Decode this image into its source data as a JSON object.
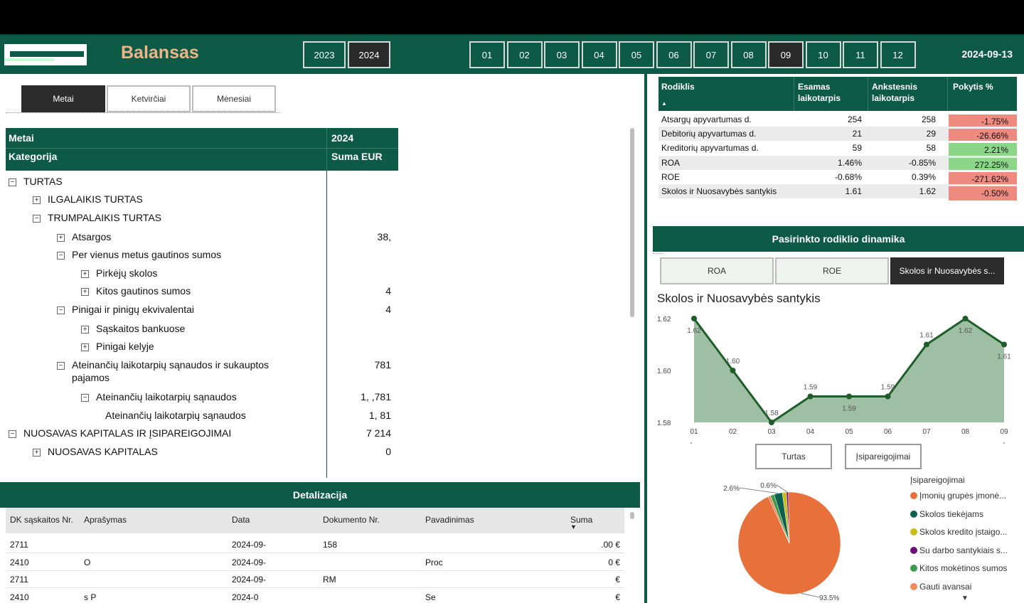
{
  "header": {
    "title": "Balansas",
    "years": [
      "2023",
      "2024"
    ],
    "selected_year": "2024",
    "months": [
      "01",
      "02",
      "03",
      "04",
      "05",
      "06",
      "07",
      "08",
      "09",
      "10",
      "11",
      "12"
    ],
    "selected_month": "09",
    "date": "2024-09-13"
  },
  "period_tabs": [
    "Metai",
    "Ketvirčiai",
    "Mėnesiai"
  ],
  "matrix": {
    "col1_row1": "Metai",
    "col2_row1": "2024",
    "col1_row2": "Kategorija",
    "col2_row2": "Suma EUR",
    "rows": [
      {
        "label": "TURTAS",
        "toggle": "−",
        "value": ""
      },
      {
        "label": "ILGALAIKIS TURTAS",
        "toggle": "+",
        "value": ""
      },
      {
        "label": "TRUMPALAIKIS TURTAS",
        "toggle": "−",
        "value": ""
      },
      {
        "label": "Atsargos",
        "toggle": "+",
        "value": "38,"
      },
      {
        "label": "Per vienus metus gautinos sumos",
        "toggle": "−",
        "value": ""
      },
      {
        "label": "Pirkėjų skolos",
        "toggle": "+",
        "value": ""
      },
      {
        "label": "Kitos gautinos sumos",
        "toggle": "+",
        "value": "4"
      },
      {
        "label": "Pinigai ir pinigų ekvivalentai",
        "toggle": "−",
        "value": "4"
      },
      {
        "label": "Sąskaitos bankuose",
        "toggle": "+",
        "value": ""
      },
      {
        "label": "Pinigai kelyje",
        "toggle": "+",
        "value": ""
      },
      {
        "label": "Ateinančių laikotarpių sąnaudos ir sukauptos",
        "label2": "pajamos",
        "toggle": "−",
        "value": "781"
      },
      {
        "label": "Ateinančių laikotarpių sąnaudos",
        "toggle": "−",
        "value": "1,    ,781"
      },
      {
        "label": "Ateinančių laikotarpių sąnaudos",
        "toggle": "",
        "value": "1,      81"
      },
      {
        "label": "NUOSAVAS KAPITALAS IR ĮSIPAREIGOJIMAI",
        "toggle": "−",
        "value": "7      214"
      },
      {
        "label": "NUOSAVAS KAPITALAS",
        "toggle": "+",
        "value": "0"
      }
    ]
  },
  "detail": {
    "title": "Detalizacija",
    "columns": [
      "DK sąskaitos Nr.",
      "Aprašymas",
      "Data",
      "Dokumento Nr.",
      "Pavadinimas",
      "Suma"
    ],
    "rows": [
      [
        "2711",
        "",
        "2024-09-",
        "158",
        "",
        ".00 €"
      ],
      [
        "2410",
        "O",
        "2024-09-",
        "",
        "Proc",
        "0 €"
      ],
      [
        "2711",
        "",
        "2024-09-",
        "RM",
        "",
        "€"
      ],
      [
        "2410",
        "s P",
        "2024-0",
        "",
        "Se",
        "€"
      ]
    ]
  },
  "kpi": {
    "columns": [
      "Rodiklis",
      "Esamas\nlaikotarpis",
      "Ankstesnis\nlaikotarpis",
      "Pokytis %"
    ],
    "rows": [
      {
        "name": "Atsargų apyvartumas d.",
        "cur": "254",
        "prev": "258",
        "chg": "-1.75%",
        "color": "#ee8a80"
      },
      {
        "name": "Debitorių apyvartumas d.",
        "cur": "21",
        "prev": "29",
        "chg": "-26.66%",
        "color": "#ee8a80"
      },
      {
        "name": "Kreditorių apyvartumas d.",
        "cur": "59",
        "prev": "58",
        "chg": "2.21%",
        "color": "#8cd68a"
      },
      {
        "name": "ROA",
        "cur": "1.46%",
        "prev": "-0.85%",
        "chg": "272.25%",
        "color": "#8cd68a"
      },
      {
        "name": "ROE",
        "cur": "-0.68%",
        "prev": "0.39%",
        "chg": "-271.62%",
        "color": "#ee8a80"
      },
      {
        "name": "Skolos ir Nuosavybės santykis",
        "cur": "1.61",
        "prev": "1.62",
        "chg": "-0.50%",
        "color": "#ee8a80"
      }
    ]
  },
  "dynamics": {
    "title": "Pasirinkto rodiklio dinamika",
    "buttons": [
      "ROA",
      "ROE",
      "Skolos ir Nuosavybės s..."
    ],
    "selected": "Skolos ir Nuosavybės s...",
    "chart_title": "Skolos ir Nuosavybės santykis",
    "toggles": [
      "Turtas",
      "Įsipareigojimai"
    ]
  },
  "chart_data": [
    {
      "type": "area",
      "title": "Skolos ir Nuosavybės santykis",
      "x": [
        "01",
        "02",
        "03",
        "04",
        "05",
        "06",
        "07",
        "08",
        "09"
      ],
      "values": [
        1.62,
        1.6,
        1.58,
        1.59,
        1.59,
        1.59,
        1.61,
        1.62,
        1.61
      ],
      "ylim": [
        1.58,
        1.62
      ],
      "yticks": [
        "1.58",
        "1.60",
        "1.62"
      ],
      "color": "#1d5e28",
      "fill": "#9fbfa4"
    },
    {
      "type": "pie",
      "legend_title": "Įsipareigojimai",
      "slices": [
        {
          "name": "Įmonių grupės įmonė...",
          "value": 93.5,
          "label": "93.5%",
          "color": "#e8703a"
        },
        {
          "name": "Skolos tiekėjams",
          "value": 2.6,
          "label": "2.6%",
          "color": "#0d6050"
        },
        {
          "name": "Skolos kredito įstaigo...",
          "value": 1.3,
          "label": "",
          "color": "#c8bf14"
        },
        {
          "name": "Su darbo santykiais s...",
          "value": 0.6,
          "label": "0.6%",
          "color": "#6b0f7a"
        },
        {
          "name": "Kitos mokėtinos sumos",
          "value": 1.2,
          "label": "",
          "color": "#3c9a4a"
        },
        {
          "name": "Gauti avansai",
          "value": 0.8,
          "label": "",
          "color": "#f08a5c"
        }
      ]
    }
  ]
}
